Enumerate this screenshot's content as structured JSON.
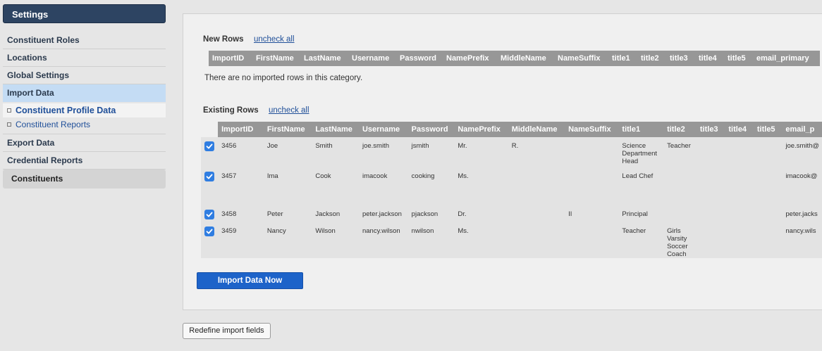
{
  "sidebar": {
    "header": "Settings",
    "items": {
      "constituent_roles": "Constituent Roles",
      "locations": "Locations",
      "global_settings": "Global Settings",
      "import_data": "Import Data",
      "constituent_profile_data": "Constituent Profile Data",
      "constituent_reports": "Constituent Reports",
      "export_data": "Export Data",
      "credential_reports": "Credential Reports",
      "constituents": "Constituents"
    }
  },
  "new_rows": {
    "label": "New Rows",
    "uncheck_all": "uncheck all",
    "columns": [
      "ImportID",
      "FirstName",
      "LastName",
      "Username",
      "Password",
      "NamePrefix",
      "MiddleName",
      "NameSuffix",
      "title1",
      "title2",
      "title3",
      "title4",
      "title5",
      "email_primary"
    ],
    "empty_message": "There are no imported rows in this category."
  },
  "existing_rows": {
    "label": "Existing Rows",
    "uncheck_all": "uncheck all",
    "columns": [
      "ImportID",
      "FirstName",
      "LastName",
      "Username",
      "Password",
      "NamePrefix",
      "MiddleName",
      "NameSuffix",
      "title1",
      "title2",
      "title3",
      "title4",
      "title5",
      "email_p"
    ],
    "rows": [
      {
        "checked": true,
        "cells": [
          "3456",
          "Joe",
          "Smith",
          "joe.smith",
          "jsmith",
          "Mr.",
          "R.",
          "",
          "Science Department Head",
          "Teacher",
          "",
          "",
          "",
          "joe.smith@"
        ]
      },
      {
        "checked": true,
        "cells": [
          "3457",
          "Ima",
          "Cook",
          "imacook",
          "cooking",
          "Ms.",
          "",
          "",
          "Lead Chef",
          "",
          "",
          "",
          "",
          "imacook@"
        ]
      },
      {
        "checked": true,
        "cells": [
          "3458",
          "Peter",
          "Jackson",
          "peter.jackson",
          "pjackson",
          "Dr.",
          "",
          "II",
          "Principal",
          "",
          "",
          "",
          "",
          "peter.jacks"
        ]
      },
      {
        "checked": true,
        "cells": [
          "3459",
          "Nancy",
          "Wilson",
          "nancy.wilson",
          "nwilson",
          "Ms.",
          "",
          "",
          "Teacher",
          "Girls Varsity Soccer Coach",
          "",
          "",
          "",
          "nancy.wils"
        ]
      }
    ]
  },
  "buttons": {
    "import_now": "Import Data Now",
    "redefine": "Redefine import fields"
  }
}
